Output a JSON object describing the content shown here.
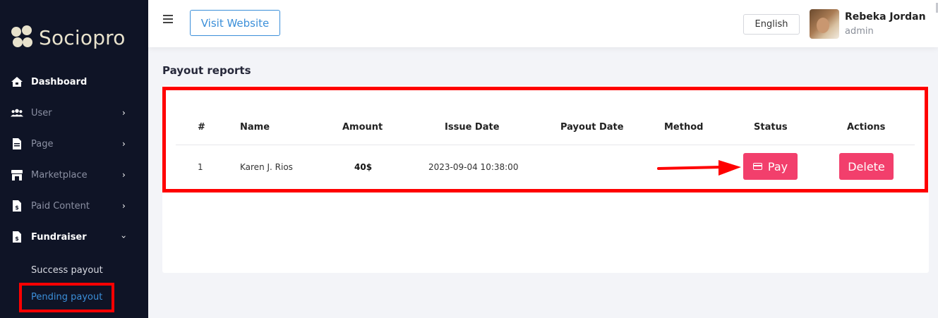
{
  "brand": {
    "name": "Sociopro"
  },
  "sidebar": {
    "items": [
      {
        "label": "Dashboard",
        "icon": "home-icon"
      },
      {
        "label": "User",
        "icon": "users-icon"
      },
      {
        "label": "Page",
        "icon": "page-icon"
      },
      {
        "label": "Marketplace",
        "icon": "store-icon"
      },
      {
        "label": "Paid Content",
        "icon": "paid-content-icon"
      },
      {
        "label": "Fundraiser",
        "icon": "fundraiser-icon"
      }
    ],
    "sub_items": [
      {
        "label": "Success payout"
      },
      {
        "label": "Pending payout"
      }
    ],
    "colors": {
      "background": "#0f1426",
      "active_sub": "#3b8fd9"
    }
  },
  "topbar": {
    "visit_label": "Visit Website",
    "language": "English",
    "user_name": "Rebeka Jordan",
    "user_role": "admin"
  },
  "main": {
    "title": "Payout reports",
    "table": {
      "headers": [
        "#",
        "Name",
        "Amount",
        "Issue Date",
        "Payout Date",
        "Method",
        "Status",
        "Actions"
      ],
      "rows": [
        {
          "index": "1",
          "name": "Karen J. Rios",
          "amount": "40$",
          "issue_date": "2023-09-04 10:38:00",
          "payout_date": "",
          "method": ""
        }
      ],
      "pay_label": "Pay",
      "delete_label": "Delete"
    },
    "colors": {
      "action_button": "#f23f6c",
      "annotation": "#ff0000"
    }
  }
}
